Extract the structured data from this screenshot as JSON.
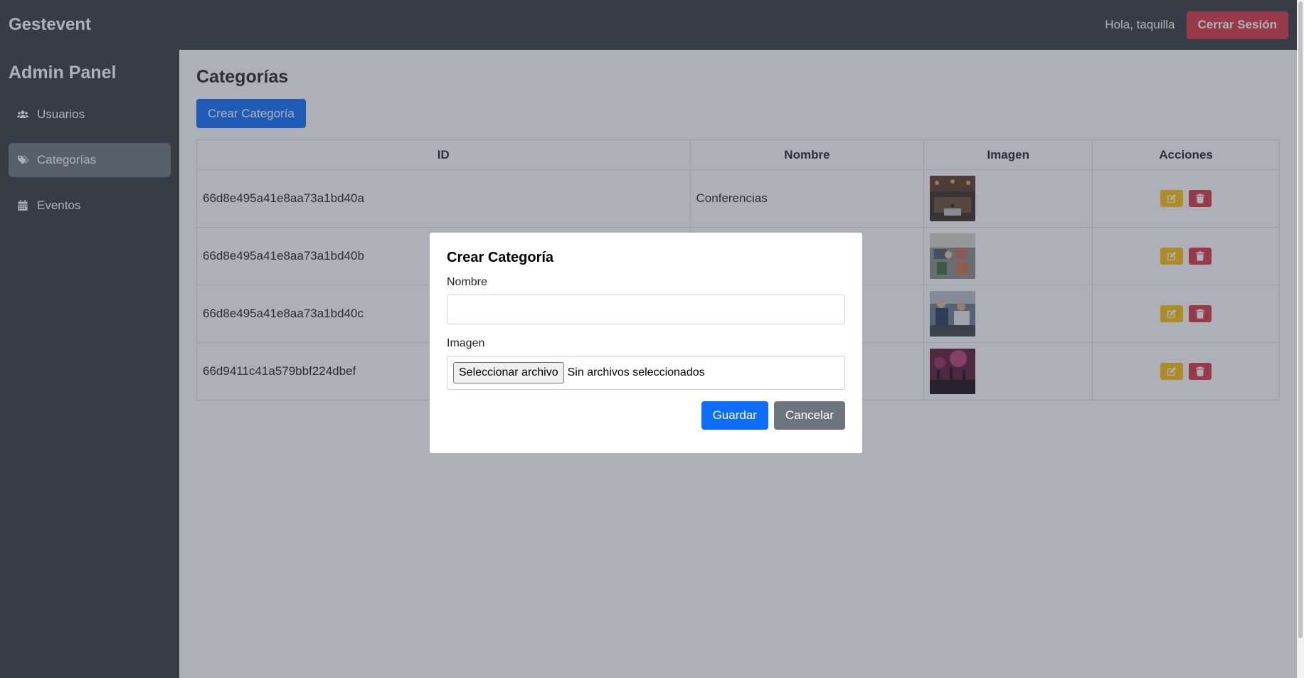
{
  "header": {
    "brand": "Gestevent",
    "greeting": "Hola, taquilla",
    "logout_label": "Cerrar Sesión"
  },
  "sidebar": {
    "title": "Admin Panel",
    "items": [
      {
        "label": "Usuarios",
        "icon": "users-icon",
        "active": false
      },
      {
        "label": "Categorías",
        "icon": "tags-icon",
        "active": true
      },
      {
        "label": "Eventos",
        "icon": "calendar-icon",
        "active": false
      }
    ]
  },
  "main": {
    "title": "Categorías",
    "create_label": "Crear Categoría",
    "table": {
      "headers": [
        "ID",
        "Nombre",
        "Imagen",
        "Acciones"
      ],
      "rows": [
        {
          "id": "66d8e495a41e8aa73a1bd40a",
          "nombre": "Conferencias"
        },
        {
          "id": "66d8e495a41e8aa73a1bd40b",
          "nombre": ""
        },
        {
          "id": "66d8e495a41e8aa73a1bd40c",
          "nombre": ""
        },
        {
          "id": "66d9411c41a579bbf224dbef",
          "nombre": ""
        }
      ]
    }
  },
  "modal": {
    "title": "Crear Categoría",
    "nombre_label": "Nombre",
    "nombre_value": "",
    "imagen_label": "Imagen",
    "file_button_label": "Seleccionar archivo",
    "file_status": "Sin archivos seleccionados",
    "save_label": "Guardar",
    "cancel_label": "Cancelar"
  },
  "colors": {
    "primary": "#0d6efd",
    "danger": "#dc3545",
    "warning": "#ffc107",
    "secondary": "#6c757d",
    "dark": "#343a40"
  }
}
